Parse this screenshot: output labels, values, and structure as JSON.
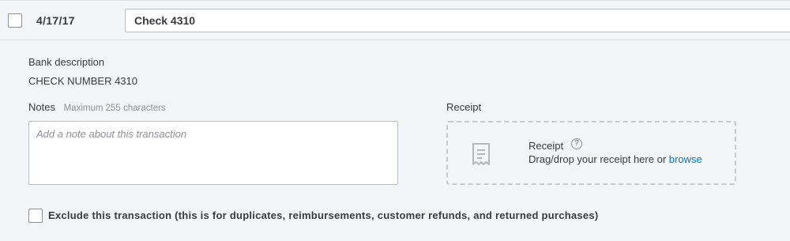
{
  "transaction": {
    "date": "4/17/17",
    "payee_value": "Check 4310"
  },
  "bank_description": {
    "label": "Bank description",
    "value": "CHECK NUMBER 4310"
  },
  "notes": {
    "label": "Notes",
    "hint": "Maximum 255 characters",
    "placeholder": "Add a note about this transaction"
  },
  "receipt": {
    "label": "Receipt",
    "title": "Receipt",
    "help_icon": "?",
    "drop_text": "Drag/drop your receipt here or",
    "browse_label": "browse"
  },
  "exclude": {
    "label": "Exclude this transaction (this is for duplicates, reimbursements, customer refunds, and returned purchases)"
  },
  "icons": {
    "row_checkbox": "checkbox-icon",
    "receipt": "receipt-icon",
    "help": "help-icon",
    "exclude_checkbox": "checkbox-icon"
  },
  "colors": {
    "background": "#f4f5f8",
    "text": "#393a3d",
    "muted": "#8d9096",
    "link": "#0077c5",
    "border": "#babec5"
  }
}
